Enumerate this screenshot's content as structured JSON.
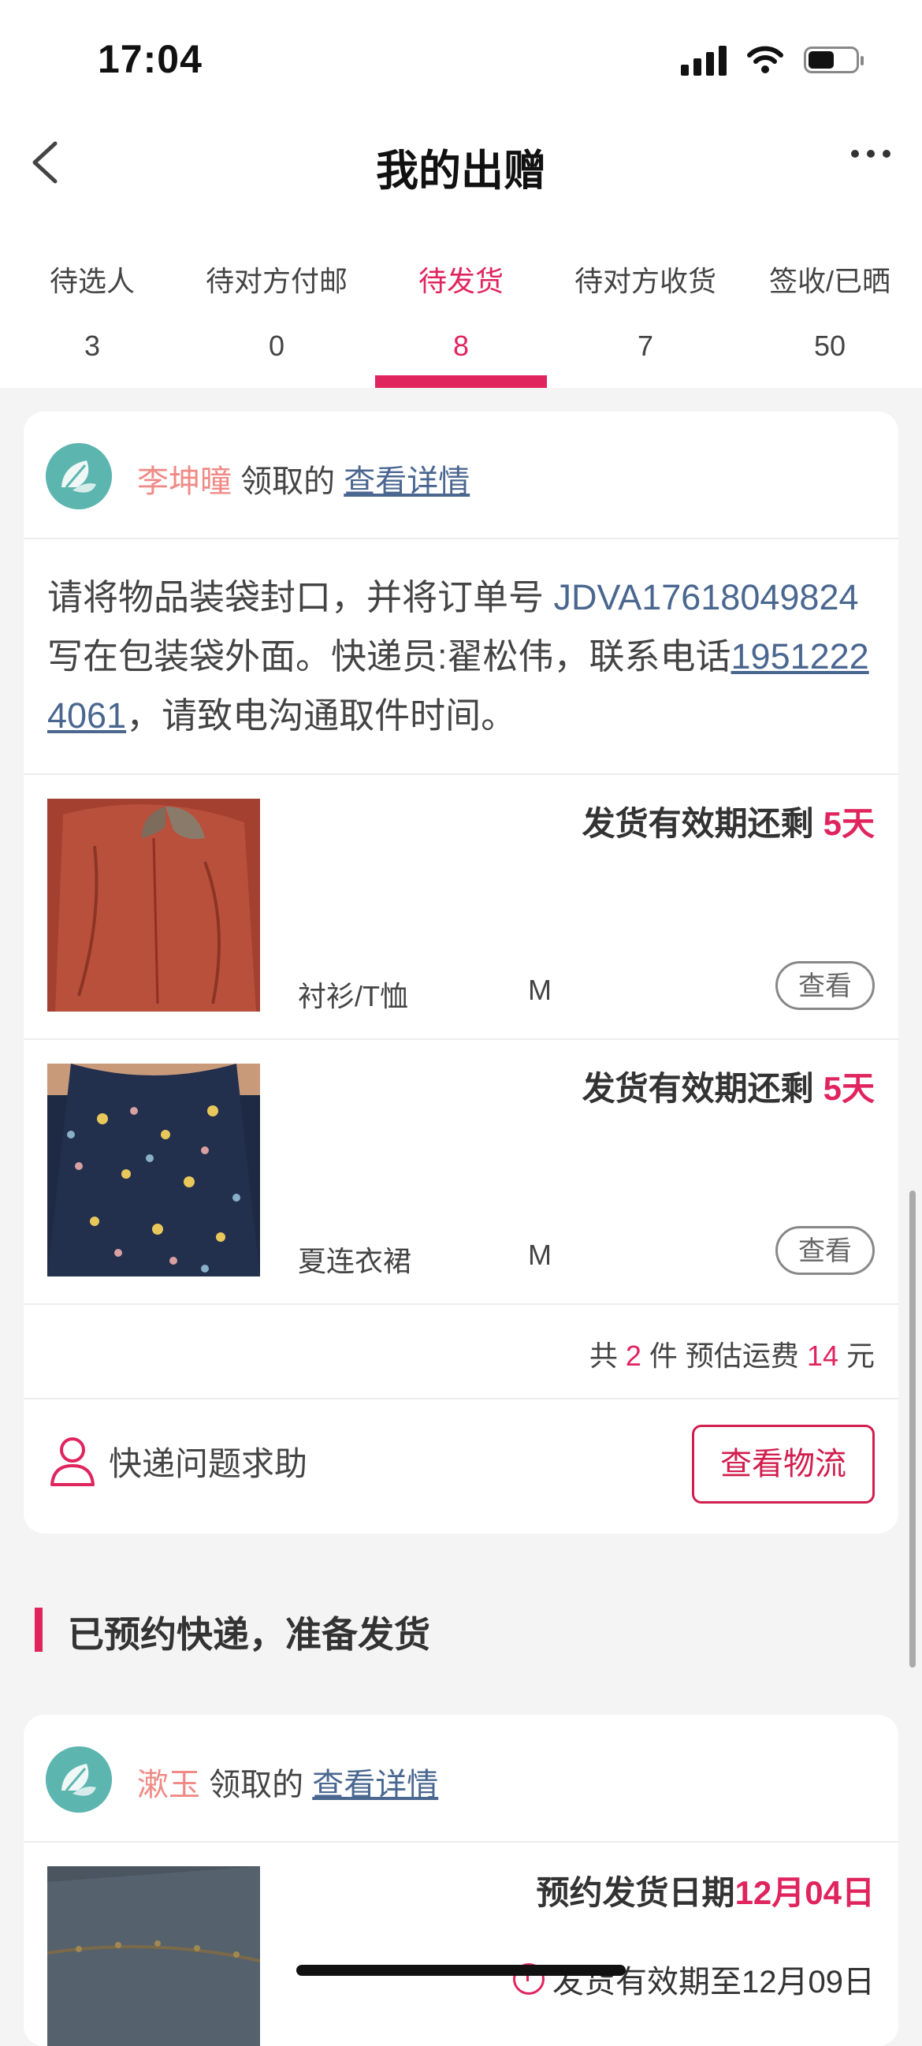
{
  "status_bar": {
    "time": "17:04"
  },
  "nav": {
    "title": "我的出赠"
  },
  "tabs": [
    {
      "label": "待选人",
      "count": "3"
    },
    {
      "label": "待对方付邮",
      "count": "0"
    },
    {
      "label": "待发货",
      "count": "8",
      "active": true
    },
    {
      "label": "待对方收货",
      "count": "7"
    },
    {
      "label": "签收/已晒",
      "count": "50"
    }
  ],
  "card1": {
    "claimer": "李坤曈",
    "claim_suffix": "领取的",
    "detail_link": "查看详情",
    "instructions": {
      "part1": "请将物品装袋封口，并将订单号 ",
      "order_no": "JDVA17618049824",
      "part2": " 写在包装袋外面。快递员:翟松伟，联系电话",
      "phone": "19512224061",
      "part3": "，请致电沟通取件时间。"
    },
    "items": [
      {
        "deadline_label": "发货有效期还剩",
        "days": "5天",
        "category": "衬衫/T恤",
        "size": "M",
        "view_label": "查看",
        "image": "red-shirt"
      },
      {
        "deadline_label": "发货有效期还剩",
        "days": "5天",
        "category": "夏连衣裙",
        "size": "M",
        "view_label": "查看",
        "image": "navy-floral-dress"
      }
    ],
    "summary": {
      "prefix": "共",
      "count": "2",
      "mid": "件 预估运费",
      "fee": "14",
      "suffix": "元"
    },
    "footer": {
      "help_label": "快递问题求助",
      "logistics_button": "查看物流"
    }
  },
  "section_heading": "已预约快递，准备发货",
  "card2": {
    "claimer": "漱玉",
    "claim_suffix": "领取的",
    "detail_link": "查看详情",
    "date_label": "预约发货日期",
    "date_value": "12月04日",
    "expiry": "发货有效期至12月09日"
  },
  "colors": {
    "accent": "#e0245e",
    "link": "#4a6790",
    "claimer": "#f08a86",
    "avatar": "#5db5b0"
  }
}
